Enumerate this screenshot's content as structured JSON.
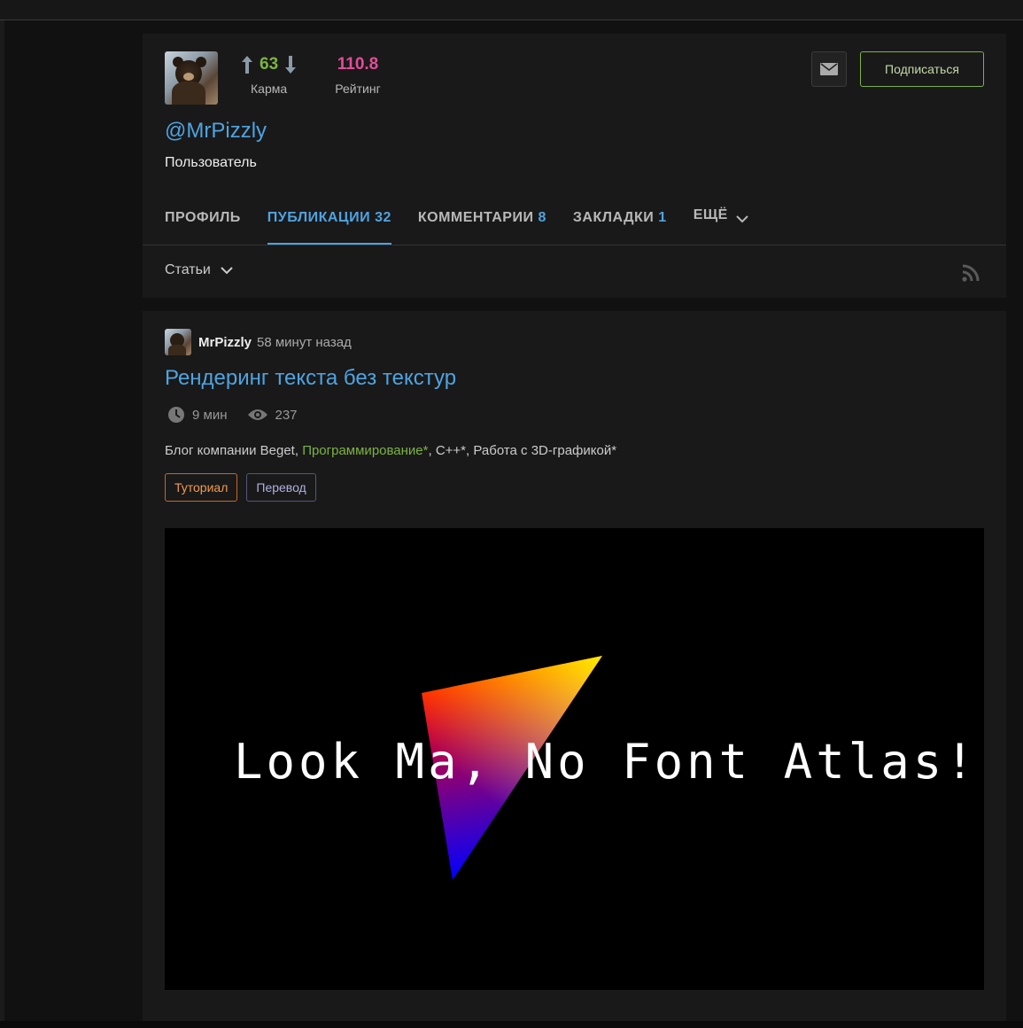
{
  "profile": {
    "avatar_alt": "MrPizzly avatar",
    "karma_value": "63",
    "karma_label": "Карма",
    "rating_value": "110.8",
    "rating_label": "Рейтинг",
    "username": "@MrPizzly",
    "role": "Пользователь",
    "subscribe_label": "Подписаться",
    "tabs": [
      {
        "label": "ПРОФИЛЬ",
        "count": ""
      },
      {
        "label": "ПУБЛИКАЦИИ",
        "count": "32"
      },
      {
        "label": "КОММЕНТАРИИ",
        "count": "8"
      },
      {
        "label": "ЗАКЛАДКИ",
        "count": "1"
      },
      {
        "label": "ЕЩЁ",
        "count": ""
      }
    ],
    "active_tab": "ПУБЛИКАЦИИ",
    "filter_label": "Статьи"
  },
  "article": {
    "author": "MrPizzly",
    "time": "58 минут назад",
    "title": "Рендеринг текста без текстур",
    "read_time": "9 мин",
    "views": "237",
    "hubs": {
      "h1": "Блог компании Beget",
      "sep": ", ",
      "h2": "Программирование*",
      "h3": "C++*",
      "h4": "Работа с 3D-графикой*"
    },
    "labels": [
      "Туториал",
      "Перевод"
    ],
    "hero_text": "Look Ma, No Font Atlas!!!"
  },
  "colors": {
    "accent_blue": "#4fa3e0",
    "karma_green": "#7cb342",
    "rating_pink": "#e34c9a",
    "tutorial_orange": "#f29a50",
    "background": "#191919"
  },
  "icons": [
    "arrow-up-icon",
    "arrow-down-icon",
    "mail-icon",
    "chevron-down-icon",
    "rss-icon",
    "clock-icon",
    "eye-icon"
  ]
}
